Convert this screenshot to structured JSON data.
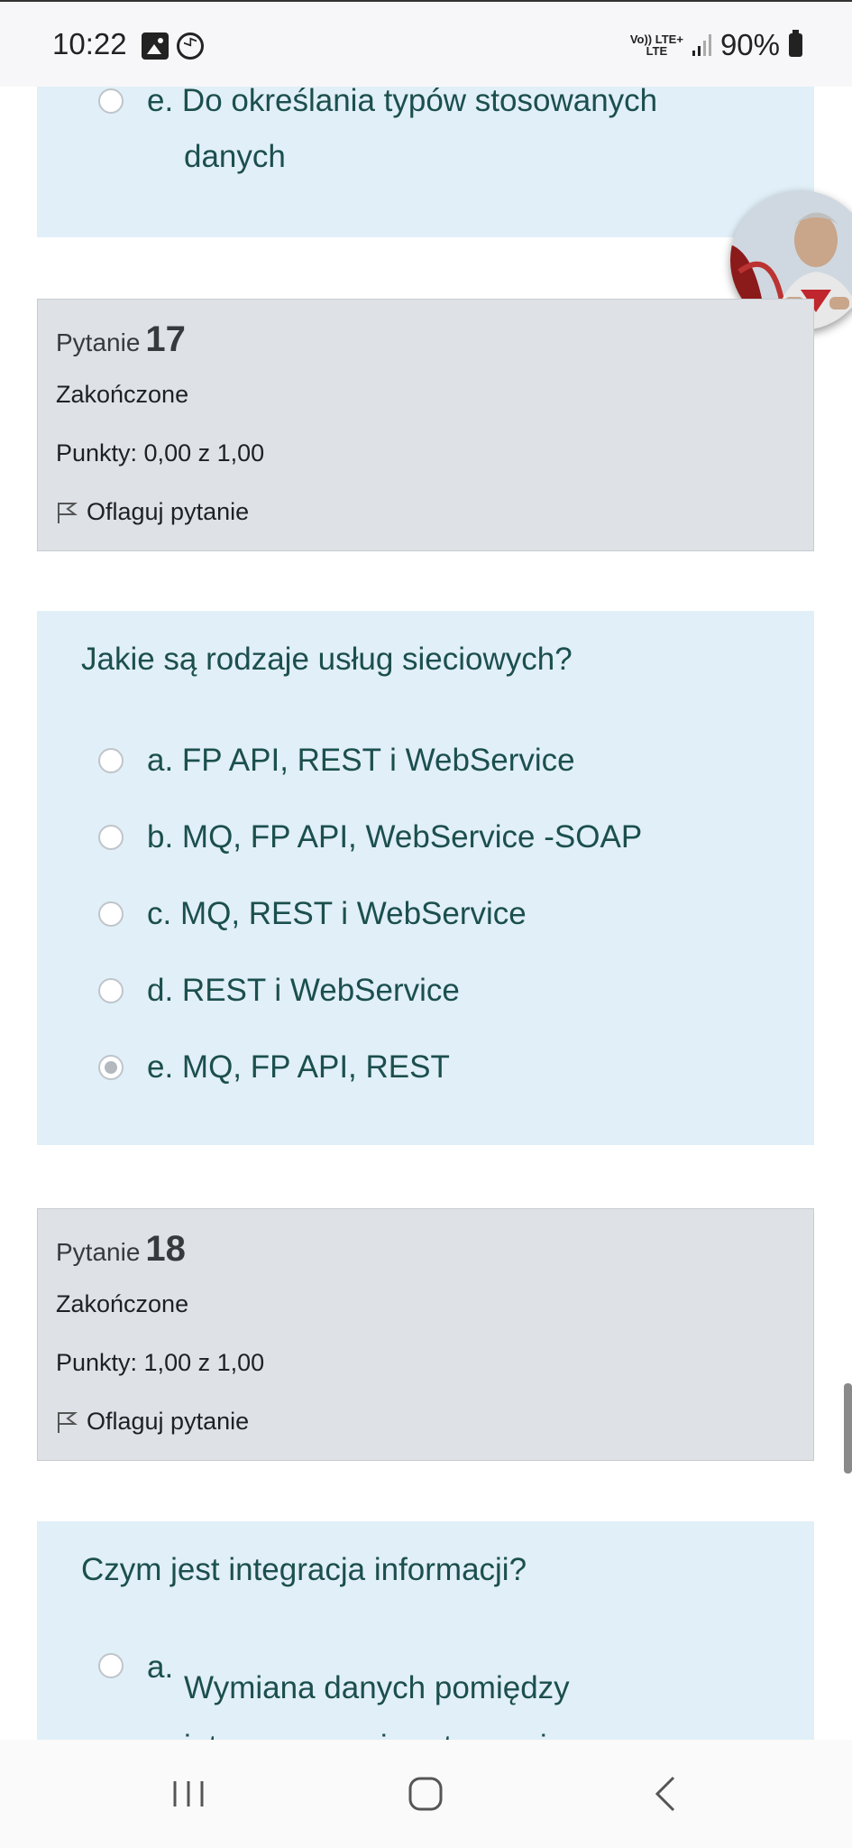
{
  "status_bar": {
    "time": "10:22",
    "network_top": "Vo)) LTE+",
    "network_bottom": "LTE",
    "battery": "90%",
    "icons": [
      "gallery-icon",
      "messenger-icon",
      "signal-icon",
      "battery-icon"
    ]
  },
  "previous_question": {
    "option_e_line1": "e. Do określania typów stosowanych",
    "option_e_line2": "danych"
  },
  "question17": {
    "label": "Pytanie",
    "number": "17",
    "state": "Zakończone",
    "points": "Punkty: 0,00 z 1,00",
    "flag": "Oflaguj pytanie",
    "text": "Jakie są rodzaje usług sieciowych?",
    "options": [
      {
        "label": "a. FP API, REST i WebService",
        "checked": false
      },
      {
        "label": "b. MQ, FP API, WebService -SOAP",
        "checked": false
      },
      {
        "label": "c. MQ, REST i WebService",
        "checked": false
      },
      {
        "label": "d. REST i WebService",
        "checked": false
      },
      {
        "label": "e. MQ, FP API, REST",
        "checked": true
      }
    ]
  },
  "question18": {
    "label": "Pytanie",
    "number": "18",
    "state": "Zakończone",
    "points": "Punkty: 1,00 z 1,00",
    "flag": "Oflaguj pytanie",
    "text": "Czym jest integracja informacji?",
    "option_a_letter": "a.",
    "option_a_line1": "Wymiana danych pomiędzy",
    "option_a_line2": "integrowanymi systemami"
  },
  "colors": {
    "answer_bg": "#e1eff8",
    "info_bg": "#dee2e6",
    "answer_text": "#1b4f4d"
  }
}
